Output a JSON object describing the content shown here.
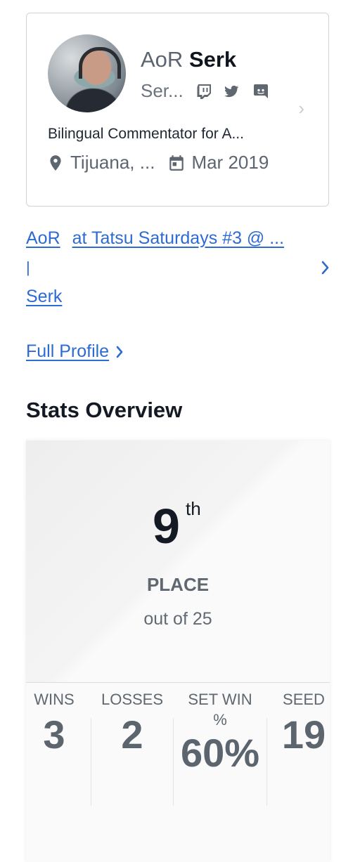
{
  "profile": {
    "prefix": "AoR",
    "gamer_tag": "Serk",
    "real_name": "Ser...",
    "bio": "Bilingual Commentator for A...",
    "location": "Tijuana, ...",
    "joined": "Mar 2019",
    "socials": [
      "twitch-icon",
      "twitter-icon",
      "discord-icon"
    ]
  },
  "event": {
    "prefix": "AoR",
    "at_text": "at",
    "event_name": "Tatsu Saturdays #3 @ ...",
    "pipe": "|",
    "gamer_tag": "Serk"
  },
  "full_profile_label": "Full Profile",
  "stats": {
    "section_title": "Stats Overview",
    "placement": "9",
    "placement_suffix": "th",
    "placement_label": "PLACE",
    "out_of": "out of 25",
    "wins_label": "WINS",
    "wins": "3",
    "losses_label": "LOSSES",
    "losses": "2",
    "set_win_label_1": "SET WIN",
    "set_win_label_2": "%",
    "set_win_pct": "60%",
    "seed_label": "SEED",
    "seed": "19"
  },
  "colors": {
    "link": "#2e6bd0",
    "text_dark": "#141a23",
    "muted": "#5f6771"
  }
}
